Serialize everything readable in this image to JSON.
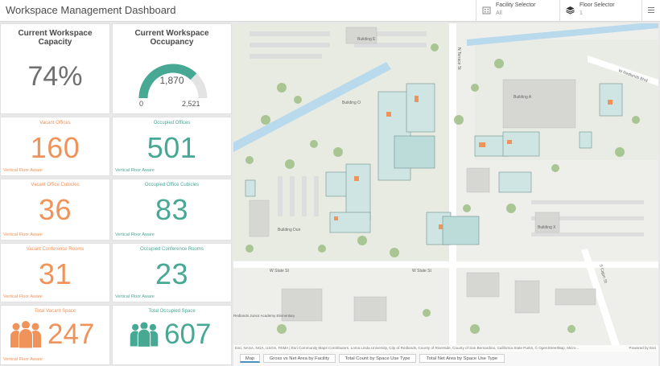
{
  "header": {
    "title": "Workspace Management Dashboard",
    "facility_selector": {
      "label": "Facility Selector",
      "value": "All"
    },
    "floor_selector": {
      "label": "Floor Selector",
      "value": "1"
    }
  },
  "capacity": {
    "title": "Current Workspace Capacity",
    "value": "74%"
  },
  "occupancy": {
    "title": "Current Workspace Occupancy",
    "value": "1,870",
    "min": "0",
    "max": "2,521",
    "fraction": 0.742
  },
  "cards": {
    "vacant_offices": {
      "title": "Vacant Offices",
      "value": "160",
      "footer": "Vertical Floor Aware"
    },
    "occupied_offices": {
      "title": "Occupied Offices",
      "value": "501",
      "footer": "Vertical Floor Aware"
    },
    "vacant_cubicles": {
      "title": "Vacant Office Cubicles",
      "value": "36",
      "footer": "Vertical Floor Aware"
    },
    "occupied_cubicles": {
      "title": "Occupied Office Cubicles",
      "value": "83",
      "footer": "Vertical Floor Aware"
    },
    "vacant_conference": {
      "title": "Vacant Conference Rooms",
      "value": "31",
      "footer": "Vertical Floor Aware"
    },
    "occupied_conference": {
      "title": "Occupied Conference Rooms",
      "value": "23",
      "footer": "Vertical Floor Aware"
    },
    "total_vacant": {
      "title": "Total Vacant Space",
      "value": "247",
      "footer": "Vertical Floor Aware"
    },
    "total_occupied": {
      "title": "Total Occupied Space",
      "value": "607"
    }
  },
  "map": {
    "labels": {
      "building_e": "Building E",
      "building_a": "Building A",
      "building_o": "Building O",
      "building_dun": "Building Dun",
      "building_x": "Building X",
      "street_w_state": "W State St",
      "street_n_terrace": "N Terrace St",
      "street_w_redlands": "W Redlands Blvd",
      "street_s_cajon": "S Cajon St",
      "school": "Redlands Junior Academy Elementary"
    },
    "attribution": "Esri, NASA, NGA, USGS, FEMA | Esri Community Maps Contributors, Loma Linda University, City of Redlands, County of Riverside, County of San Bernardino, California State Parks, © OpenStreetMap, Micro...",
    "powered_by": "Powered by Esri"
  },
  "tabs": [
    {
      "label": "Map"
    },
    {
      "label": "Gross vs Net Area by Facility"
    },
    {
      "label": "Total Count by Space Use Type"
    },
    {
      "label": "Total Net Area by Space Use Type"
    }
  ],
  "colors": {
    "vacant": "#f0935a",
    "occupied": "#47a894",
    "gauge_track": "#e3e3e3"
  }
}
